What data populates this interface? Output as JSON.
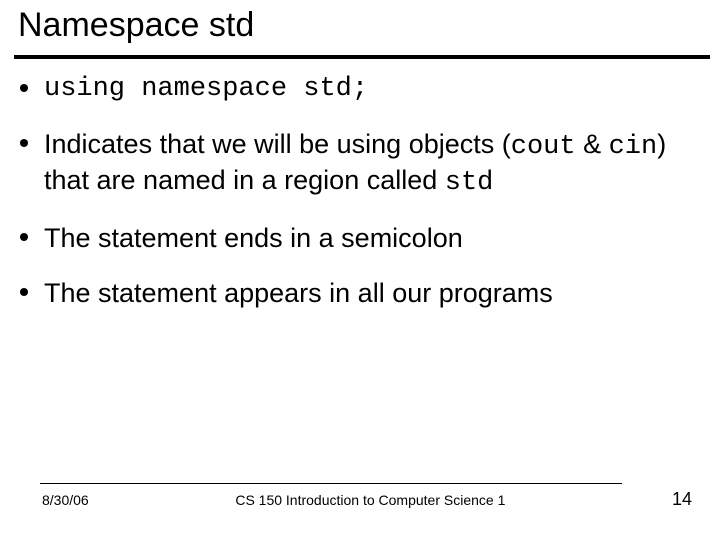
{
  "title": "Namespace std",
  "bullets": {
    "b1": "using namespace std;",
    "b2": {
      "pre": "Indicates that we will be using objects (",
      "cout": "cout",
      "amp": " & ",
      "cin": "cin",
      "mid": ") that are named in a region called ",
      "std": "std"
    },
    "b3": "The statement ends in a semicolon",
    "b4": "The statement appears in all our programs"
  },
  "footer": {
    "date": "8/30/06",
    "course": "CS 150 Introduction to Computer Science 1",
    "page": "14"
  }
}
